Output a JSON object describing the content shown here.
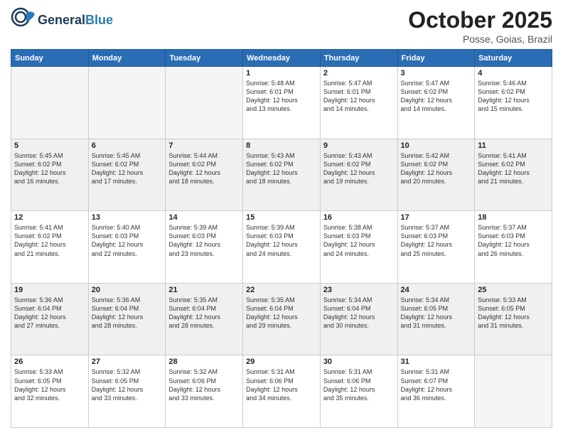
{
  "header": {
    "logo_general": "General",
    "logo_blue": "Blue",
    "month": "October 2025",
    "location": "Posse, Goias, Brazil"
  },
  "days_of_week": [
    "Sunday",
    "Monday",
    "Tuesday",
    "Wednesday",
    "Thursday",
    "Friday",
    "Saturday"
  ],
  "weeks": [
    {
      "shaded": false,
      "days": [
        {
          "num": "",
          "text": ""
        },
        {
          "num": "",
          "text": ""
        },
        {
          "num": "",
          "text": ""
        },
        {
          "num": "1",
          "text": "Sunrise: 5:48 AM\nSunset: 6:01 PM\nDaylight: 12 hours\nand 13 minutes."
        },
        {
          "num": "2",
          "text": "Sunrise: 5:47 AM\nSunset: 6:01 PM\nDaylight: 12 hours\nand 14 minutes."
        },
        {
          "num": "3",
          "text": "Sunrise: 5:47 AM\nSunset: 6:02 PM\nDaylight: 12 hours\nand 14 minutes."
        },
        {
          "num": "4",
          "text": "Sunrise: 5:46 AM\nSunset: 6:02 PM\nDaylight: 12 hours\nand 15 minutes."
        }
      ]
    },
    {
      "shaded": true,
      "days": [
        {
          "num": "5",
          "text": "Sunrise: 5:45 AM\nSunset: 6:02 PM\nDaylight: 12 hours\nand 16 minutes."
        },
        {
          "num": "6",
          "text": "Sunrise: 5:45 AM\nSunset: 6:02 PM\nDaylight: 12 hours\nand 17 minutes."
        },
        {
          "num": "7",
          "text": "Sunrise: 5:44 AM\nSunset: 6:02 PM\nDaylight: 12 hours\nand 18 minutes."
        },
        {
          "num": "8",
          "text": "Sunrise: 5:43 AM\nSunset: 6:02 PM\nDaylight: 12 hours\nand 18 minutes."
        },
        {
          "num": "9",
          "text": "Sunrise: 5:43 AM\nSunset: 6:02 PM\nDaylight: 12 hours\nand 19 minutes."
        },
        {
          "num": "10",
          "text": "Sunrise: 5:42 AM\nSunset: 6:02 PM\nDaylight: 12 hours\nand 20 minutes."
        },
        {
          "num": "11",
          "text": "Sunrise: 5:41 AM\nSunset: 6:02 PM\nDaylight: 12 hours\nand 21 minutes."
        }
      ]
    },
    {
      "shaded": false,
      "days": [
        {
          "num": "12",
          "text": "Sunrise: 5:41 AM\nSunset: 6:02 PM\nDaylight: 12 hours\nand 21 minutes."
        },
        {
          "num": "13",
          "text": "Sunrise: 5:40 AM\nSunset: 6:03 PM\nDaylight: 12 hours\nand 22 minutes."
        },
        {
          "num": "14",
          "text": "Sunrise: 5:39 AM\nSunset: 6:03 PM\nDaylight: 12 hours\nand 23 minutes."
        },
        {
          "num": "15",
          "text": "Sunrise: 5:39 AM\nSunset: 6:03 PM\nDaylight: 12 hours\nand 24 minutes."
        },
        {
          "num": "16",
          "text": "Sunrise: 5:38 AM\nSunset: 6:03 PM\nDaylight: 12 hours\nand 24 minutes."
        },
        {
          "num": "17",
          "text": "Sunrise: 5:37 AM\nSunset: 6:03 PM\nDaylight: 12 hours\nand 25 minutes."
        },
        {
          "num": "18",
          "text": "Sunrise: 5:37 AM\nSunset: 6:03 PM\nDaylight: 12 hours\nand 26 minutes."
        }
      ]
    },
    {
      "shaded": true,
      "days": [
        {
          "num": "19",
          "text": "Sunrise: 5:36 AM\nSunset: 6:04 PM\nDaylight: 12 hours\nand 27 minutes."
        },
        {
          "num": "20",
          "text": "Sunrise: 5:36 AM\nSunset: 6:04 PM\nDaylight: 12 hours\nand 28 minutes."
        },
        {
          "num": "21",
          "text": "Sunrise: 5:35 AM\nSunset: 6:04 PM\nDaylight: 12 hours\nand 28 minutes."
        },
        {
          "num": "22",
          "text": "Sunrise: 5:35 AM\nSunset: 6:04 PM\nDaylight: 12 hours\nand 29 minutes."
        },
        {
          "num": "23",
          "text": "Sunrise: 5:34 AM\nSunset: 6:04 PM\nDaylight: 12 hours\nand 30 minutes."
        },
        {
          "num": "24",
          "text": "Sunrise: 5:34 AM\nSunset: 6:05 PM\nDaylight: 12 hours\nand 31 minutes."
        },
        {
          "num": "25",
          "text": "Sunrise: 5:33 AM\nSunset: 6:05 PM\nDaylight: 12 hours\nand 31 minutes."
        }
      ]
    },
    {
      "shaded": false,
      "days": [
        {
          "num": "26",
          "text": "Sunrise: 5:33 AM\nSunset: 6:05 PM\nDaylight: 12 hours\nand 32 minutes."
        },
        {
          "num": "27",
          "text": "Sunrise: 5:32 AM\nSunset: 6:05 PM\nDaylight: 12 hours\nand 33 minutes."
        },
        {
          "num": "28",
          "text": "Sunrise: 5:32 AM\nSunset: 6:06 PM\nDaylight: 12 hours\nand 33 minutes."
        },
        {
          "num": "29",
          "text": "Sunrise: 5:31 AM\nSunset: 6:06 PM\nDaylight: 12 hours\nand 34 minutes."
        },
        {
          "num": "30",
          "text": "Sunrise: 5:31 AM\nSunset: 6:06 PM\nDaylight: 12 hours\nand 35 minutes."
        },
        {
          "num": "31",
          "text": "Sunrise: 5:31 AM\nSunset: 6:07 PM\nDaylight: 12 hours\nand 36 minutes."
        },
        {
          "num": "",
          "text": ""
        }
      ]
    }
  ]
}
